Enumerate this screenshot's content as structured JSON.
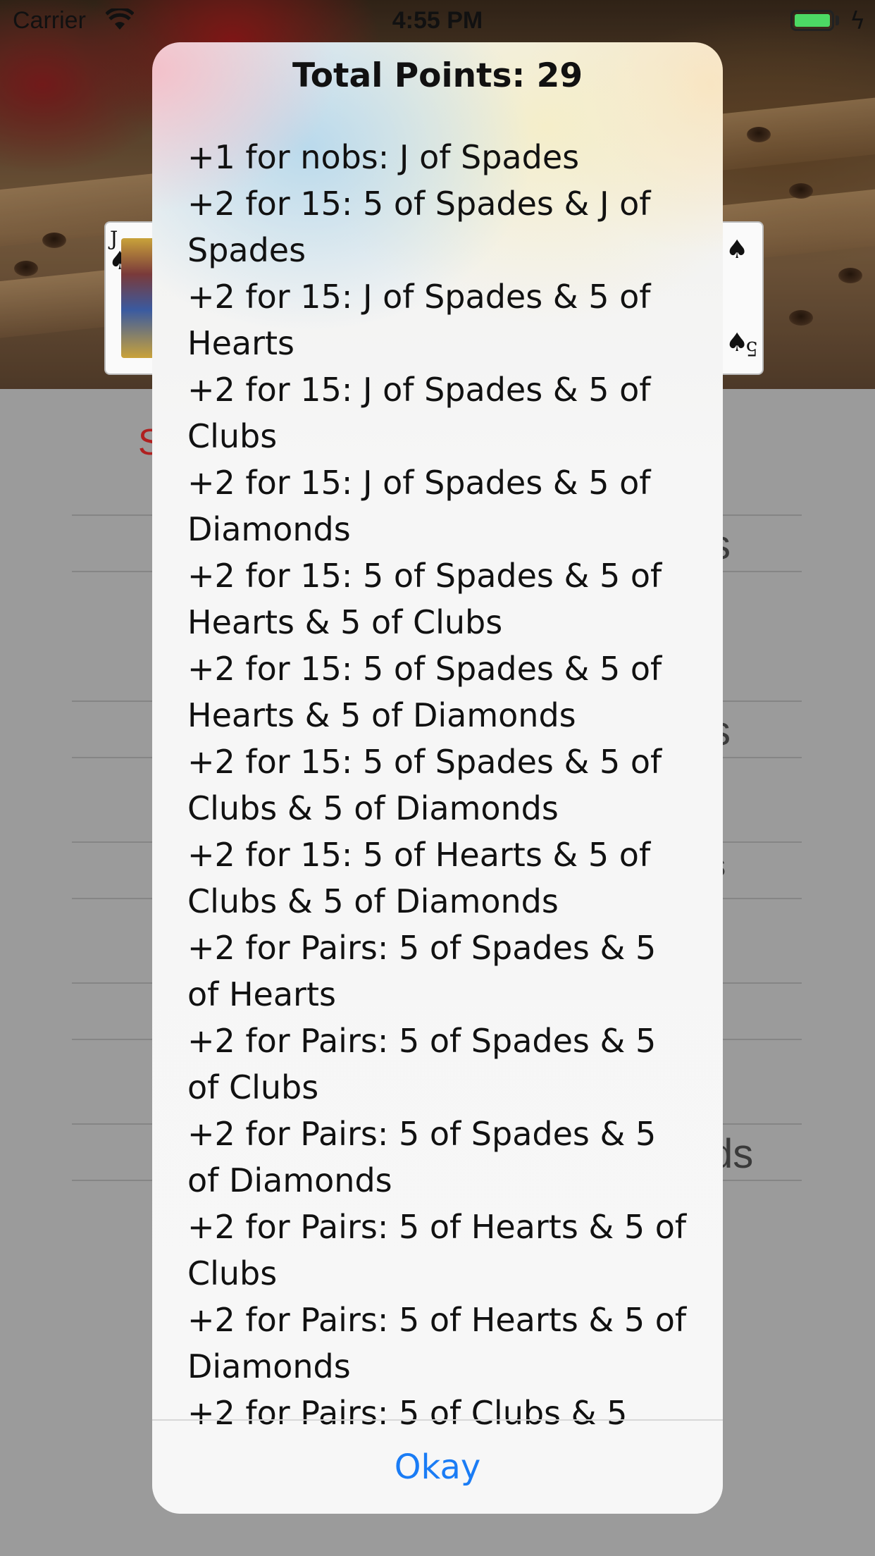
{
  "status_bar": {
    "carrier": "Carrier",
    "time": "4:55 PM"
  },
  "background": {
    "red_label": "S",
    "right_labels": [
      "s",
      "s",
      "s",
      "ds"
    ]
  },
  "alert": {
    "title": "Total Points: 29",
    "message": "+1 for nobs: J of Spades\n+2 for 15: 5 of Spades & J of Spades\n+2 for 15: J of Spades & 5 of Hearts\n+2 for 15: J of Spades & 5 of Clubs\n+2 for 15: J of Spades & 5 of Diamonds\n+2 for 15: 5 of Spades & 5 of Hearts & 5 of Clubs\n+2 for 15: 5 of Spades & 5 of Hearts & 5 of Diamonds\n+2 for 15: 5 of Spades & 5 of Clubs & 5 of Diamonds\n+2 for 15: 5 of Hearts & 5 of Clubs & 5 of Diamonds\n+2 for Pairs: 5 of Spades & 5 of Hearts\n+2 for Pairs: 5 of Spades & 5 of Clubs\n+2 for Pairs: 5 of Spades & 5 of Diamonds\n+2 for Pairs: 5 of Hearts & 5 of Clubs\n+2 for Pairs: 5 of Hearts & 5 of Diamonds\n+2 for Pairs: 5 of Clubs & 5",
    "action_label": "Okay"
  },
  "colors": {
    "accent": "#1a7cf5",
    "battery": "#4cd964",
    "dim_background": "#9b9b9b"
  }
}
